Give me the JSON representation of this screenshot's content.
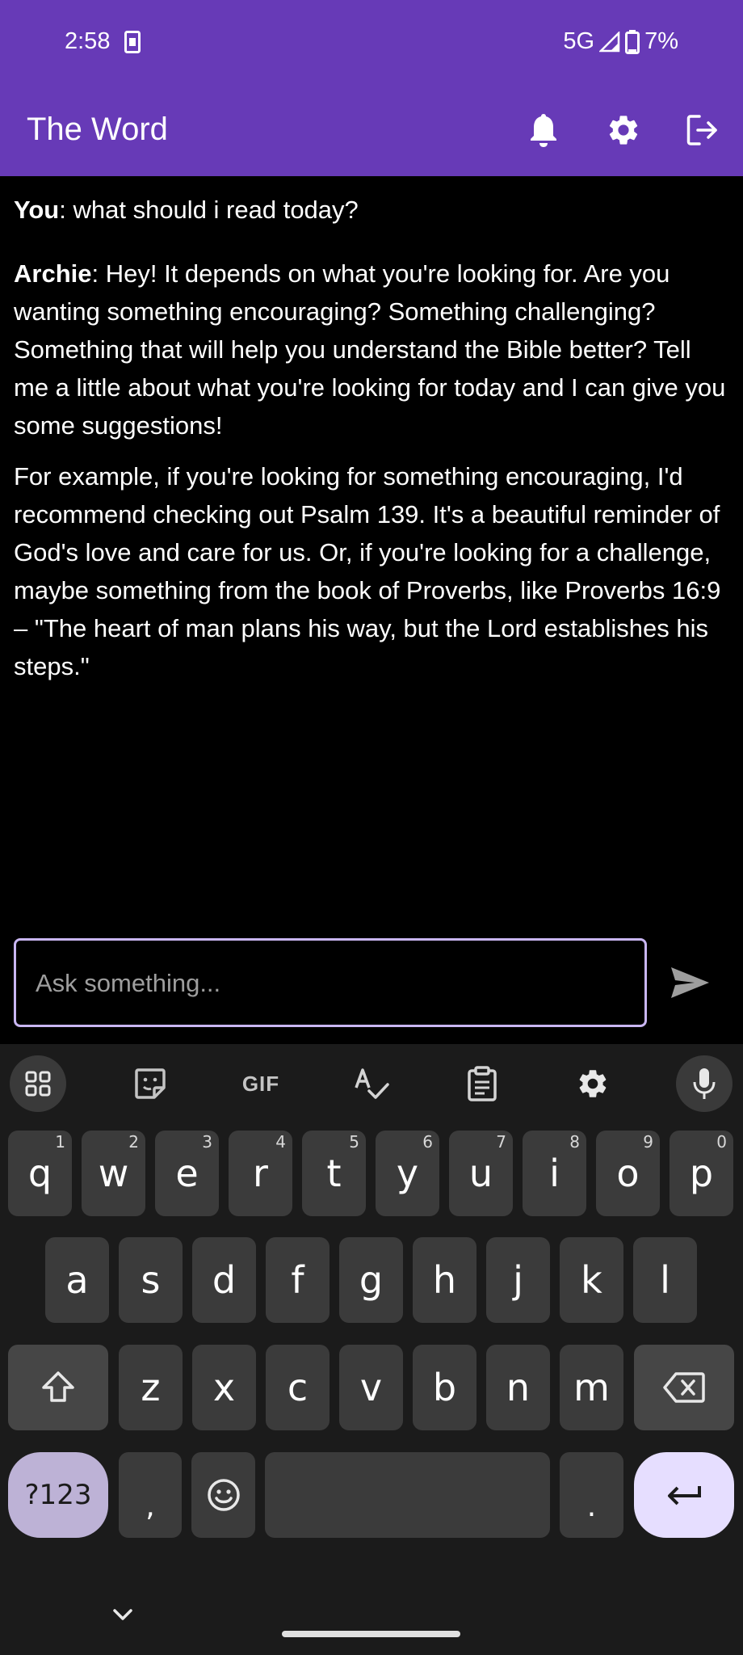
{
  "status_bar": {
    "time": "2:58",
    "network": "5G",
    "battery": "7%"
  },
  "app_bar": {
    "title": "The Word",
    "actions": [
      "bell-icon",
      "gear-icon",
      "logout-icon"
    ]
  },
  "chat": {
    "messages": [
      {
        "speaker": "You",
        "paragraphs": [
          "what should i read today?"
        ]
      },
      {
        "speaker": "Archie",
        "paragraphs": [
          "Hey! It depends on what you're looking for.  Are you wanting something encouraging?  Something challenging? Something that will help you understand the Bible better?  Tell me a little about what you're looking for today and I can give you some suggestions!",
          "For example, if you're looking for something encouraging, I'd recommend checking out Psalm 139.  It's a beautiful reminder of God's love and care for us.  Or, if you're looking for a challenge, maybe something from the book of Proverbs, like Proverbs 16:9 – \"The heart of man plans his way, but the Lord establishes his steps.\""
        ]
      }
    ]
  },
  "input": {
    "placeholder": "Ask something...",
    "value": ""
  },
  "keyboard": {
    "toolbar": [
      "apps-grid-icon",
      "sticker-icon",
      "GIF",
      "spellcheck-icon",
      "clipboard-icon",
      "gear-icon",
      "mic-icon"
    ],
    "row1": [
      {
        "key": "q",
        "hint": "1"
      },
      {
        "key": "w",
        "hint": "2"
      },
      {
        "key": "e",
        "hint": "3"
      },
      {
        "key": "r",
        "hint": "4"
      },
      {
        "key": "t",
        "hint": "5"
      },
      {
        "key": "y",
        "hint": "6"
      },
      {
        "key": "u",
        "hint": "7"
      },
      {
        "key": "i",
        "hint": "8"
      },
      {
        "key": "o",
        "hint": "9"
      },
      {
        "key": "p",
        "hint": "0"
      }
    ],
    "row2": [
      "a",
      "s",
      "d",
      "f",
      "g",
      "h",
      "j",
      "k",
      "l"
    ],
    "row3": [
      "z",
      "x",
      "c",
      "v",
      "b",
      "n",
      "m"
    ],
    "symbols_label": "?123",
    "comma": ",",
    "period": "."
  },
  "colors": {
    "app_bar": "#673ab7",
    "input_border": "#c9b6f2",
    "keyboard_bg": "#1b1b1b",
    "key_bg": "#3b3b3b"
  }
}
